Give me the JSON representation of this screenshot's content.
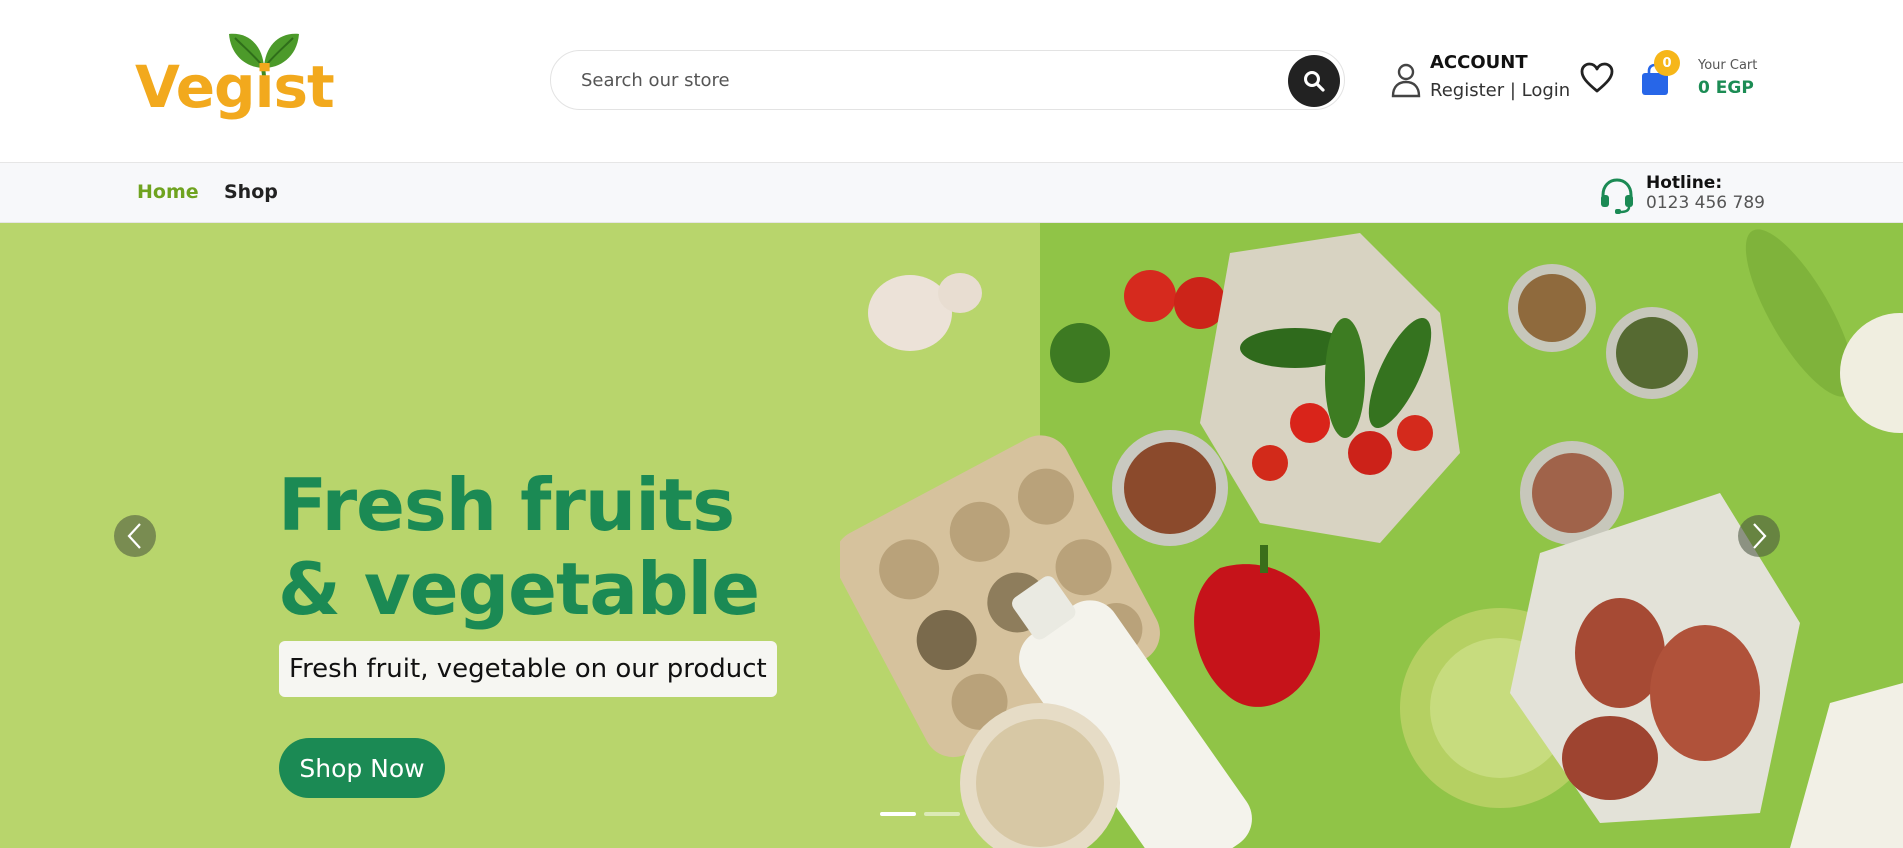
{
  "brand": {
    "name": "Vegist",
    "logo_color": "#f2a91d",
    "leaf_color": "#4c9a2a"
  },
  "search": {
    "placeholder": "Search our store",
    "icon": "search-icon"
  },
  "account": {
    "title": "ACCOUNT",
    "links": "Register | Login",
    "icon": "user-icon"
  },
  "wishlist": {
    "icon": "heart-icon"
  },
  "cart": {
    "count": "0",
    "label": "Your Cart",
    "total": "0 EGP",
    "icon": "shopping-bag-icon"
  },
  "nav": {
    "items": [
      {
        "label": "Home",
        "active": true
      },
      {
        "label": "Shop",
        "active": false
      }
    ]
  },
  "hotline": {
    "label": "Hotline:",
    "number": "0123 456 789",
    "icon": "headset-icon"
  },
  "hero": {
    "title_line1": "Fresh fruits",
    "title_line2": "& vegetable",
    "subtitle": "Fresh fruit, vegetable on our product",
    "cta": "Shop Now",
    "prev_icon": "chevron-left-icon",
    "next_icon": "chevron-right-icon",
    "slides": [
      {
        "active": true
      },
      {
        "active": false
      }
    ],
    "background_color": "#b8d56c"
  },
  "colors": {
    "primary": "#1b8a54",
    "accent": "#6fa31f",
    "badge": "#f6b619"
  }
}
